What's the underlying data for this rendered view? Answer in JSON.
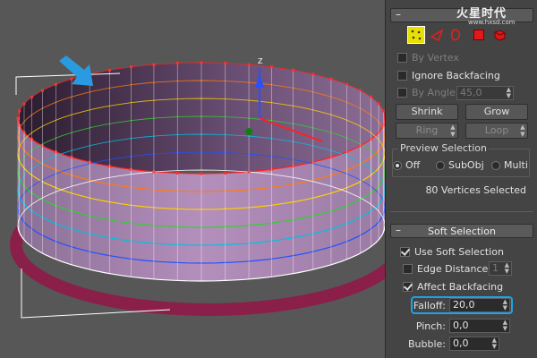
{
  "watermark": {
    "brand": "火星时代",
    "url": "www.hxsd.com"
  },
  "viewport": {
    "axis_label": "Z"
  },
  "selection": {
    "by_vertex": "By Vertex",
    "ignore_backfacing": "Ignore Backfacing",
    "by_angle": "By Angle:",
    "angle_value": "45,0",
    "shrink": "Shrink",
    "grow": "Grow",
    "ring": "Ring",
    "loop": "Loop",
    "preview_title": "Preview Selection",
    "preview_off": "Off",
    "preview_subobj": "SubObj",
    "preview_multi": "Multi",
    "status": "80 Vertices Selected"
  },
  "soft_selection": {
    "title": "Soft Selection",
    "use_soft": "Use Soft Selection",
    "edge_distance": "Edge Distance:",
    "edge_value": "1",
    "affect_backfacing": "Affect Backfacing",
    "falloff": "Falloff:",
    "falloff_value": "20,0",
    "pinch": "Pinch:",
    "pinch_value": "0,0",
    "bubble": "Bubble:",
    "bubble_value": "0,0"
  },
  "colors": {
    "highlight": "#1aa3ea",
    "arrow": "#2a9be0",
    "mesh": "#b98bbd"
  }
}
